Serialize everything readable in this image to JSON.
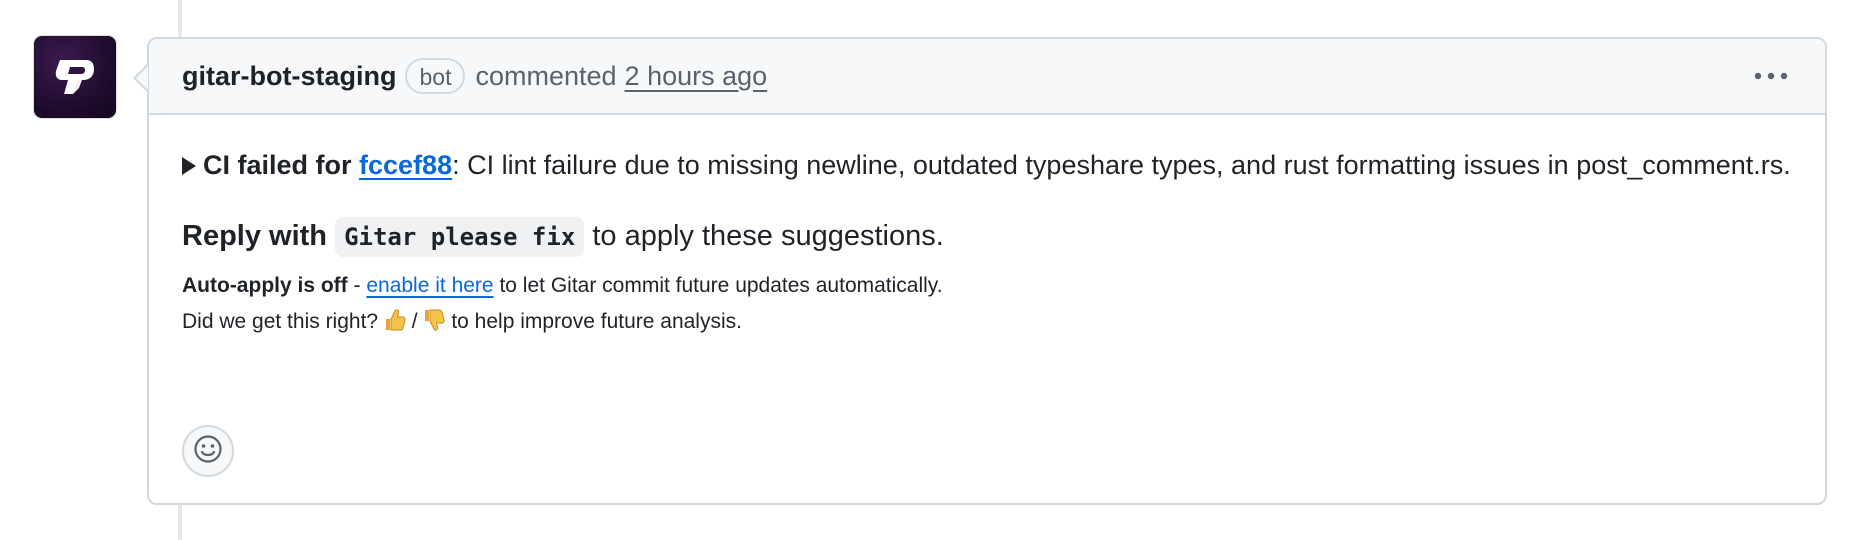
{
  "comment": {
    "author": "gitar-bot-staging",
    "badge": "bot",
    "action": "commented",
    "timestamp": "2 hours ago",
    "summary": {
      "bold_prefix": "CI failed for",
      "commit": "fccef88",
      "rest": ": CI lint failure due to missing newline, outdated typeshare types, and rust formatting issues in post_comment.rs."
    },
    "reply": {
      "bold": "Reply with",
      "code": "Gitar please fix",
      "rest": "to apply these suggestions."
    },
    "auto_apply": {
      "bold": "Auto-apply is off",
      "separator": "-",
      "link": "enable it here",
      "rest": "to let Gitar commit future updates automatically."
    },
    "feedback": {
      "question": "Did we get this right?",
      "slash": "/",
      "rest": "to help improve future analysis."
    }
  },
  "icons": {
    "avatar": "gitar-logo-icon",
    "more": "kebab-horizontal-icon",
    "reaction": "smiley-icon",
    "thumbs_up": "thumbs-up-icon",
    "thumbs_down": "thumbs-down-icon",
    "disclosure": "triangle-right-icon"
  },
  "colors": {
    "link": "#0969da",
    "muted": "#59636e",
    "border": "#d1d9e0",
    "header_bg": "#f6f8fa"
  }
}
